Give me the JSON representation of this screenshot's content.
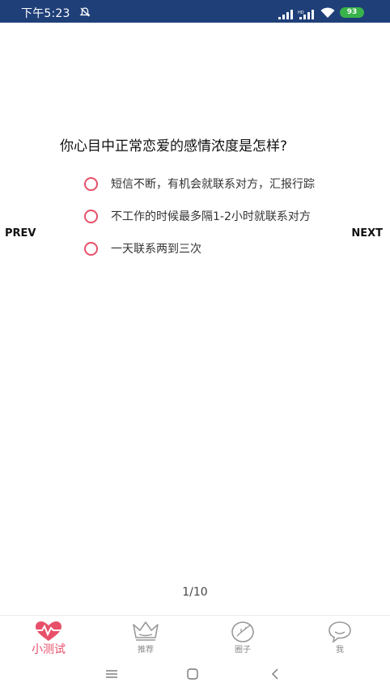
{
  "status_bar": {
    "time": "下午5:23",
    "battery": "93"
  },
  "quiz": {
    "question": "你心目中正常恋爱的感情浓度是怎样?",
    "options": [
      "短信不断，有机会就联系对方，汇报行踪",
      "不工作的时候最多隔1-2小时就联系对方",
      "一天联系两到三次"
    ],
    "prev_label": "PREV",
    "next_label": "NEXT",
    "progress": "1/10"
  },
  "tabbar": {
    "tabs": [
      {
        "label": "小测试",
        "icon": "heart-pulse-icon",
        "active": true
      },
      {
        "label": "推荐",
        "icon": "crown-icon",
        "active": false
      },
      {
        "label": "圈子",
        "icon": "leaf-icon",
        "active": false
      },
      {
        "label": "我",
        "icon": "chat-bubble-icon",
        "active": false
      }
    ]
  },
  "colors": {
    "accent": "#e8506a",
    "status_bar": "#1f3f78",
    "battery": "#38b24a"
  }
}
